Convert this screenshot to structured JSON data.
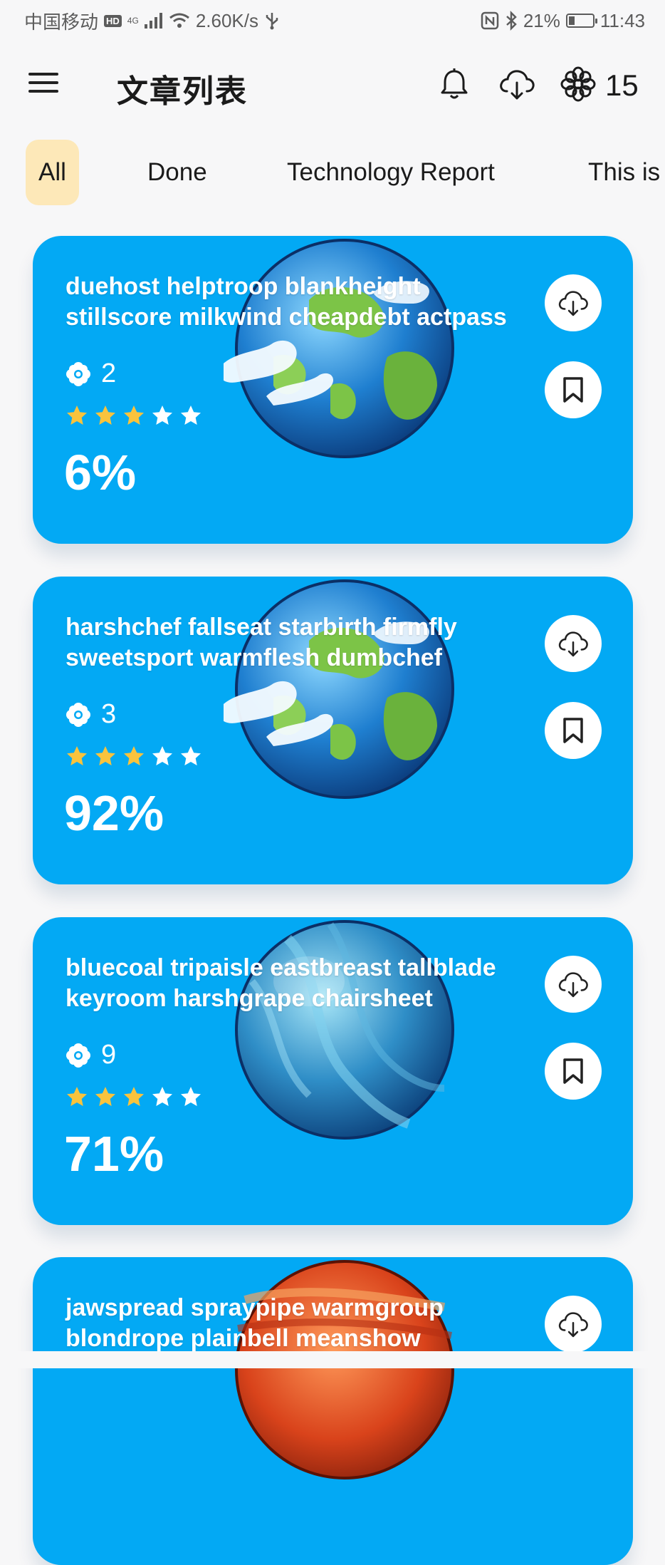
{
  "status_bar": {
    "carrier": "中国移动",
    "hd": "HD",
    "network": "4G",
    "speed": "2.60K/s",
    "battery": "21%",
    "time": "11:43"
  },
  "app_bar": {
    "title": "文章列表",
    "coin_count": "15"
  },
  "tabs": [
    {
      "label": "All",
      "active": true
    },
    {
      "label": "Done",
      "active": false
    },
    {
      "label": "Technology Report",
      "active": false
    },
    {
      "label": "This is",
      "active": false
    }
  ],
  "articles": [
    {
      "title": "duehost helptroop blankheight stillscore milkwind cheapdebt actpass",
      "coins": "2",
      "rating": 3,
      "progress": "6%",
      "planet": "earth-icon"
    },
    {
      "title": "harshchef fallseat starbirth firmfly sweetsport warmflesh dumbchef",
      "coins": "3",
      "rating": 3,
      "progress": "92%",
      "planet": "earth-icon"
    },
    {
      "title": "bluecoal tripaisle eastbreast tallblade keyroom harshgrape chairsheet",
      "coins": "9",
      "rating": 3,
      "progress": "71%",
      "planet": "neptune-icon"
    },
    {
      "title": "jawspread spraypipe warmgroup blondrope plainbell meanshow",
      "coins": "",
      "rating": 0,
      "progress": "",
      "planet": "mars-icon"
    }
  ],
  "colors": {
    "card": "#03a9f4",
    "active_tab": "#fde8b8",
    "star_filled": "#f9c33d",
    "star_empty": "#ffffff"
  }
}
